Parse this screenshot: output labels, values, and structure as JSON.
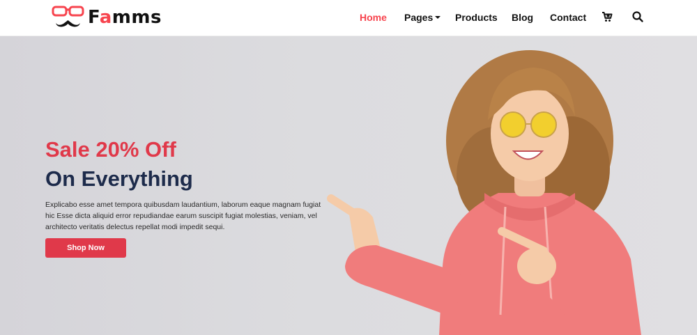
{
  "brand": {
    "name_prefix": "F",
    "name_accent": "a",
    "name_suffix": "mms",
    "accent_color": "#f7444e",
    "logo_icon": "glasses-mustache-icon"
  },
  "nav": {
    "items": [
      {
        "label": "Home",
        "active": true
      },
      {
        "label": "Pages",
        "active": false,
        "has_dropdown": true
      },
      {
        "label": "Products",
        "active": false
      },
      {
        "label": "Blog",
        "active": false
      },
      {
        "label": "Contact",
        "active": false
      }
    ],
    "icons": [
      "cart-icon",
      "search-icon"
    ]
  },
  "hero": {
    "headline_1": "Sale 20% Off",
    "headline_2": "On Everything",
    "description": "Explicabo esse amet tempora quibusdam laudantium, laborum eaque magnam fugiat hic Esse dicta aliquid error repudiandae earum suscipit fugiat molestias, veniam, vel architecto veritatis delectus repellat modi impedit sequi.",
    "cta_label": "Shop Now",
    "colors": {
      "headline_1": "#e0394a",
      "headline_2": "#1d2b4b",
      "cta_background": "#e0394a",
      "background": "#dcdcdf"
    }
  }
}
